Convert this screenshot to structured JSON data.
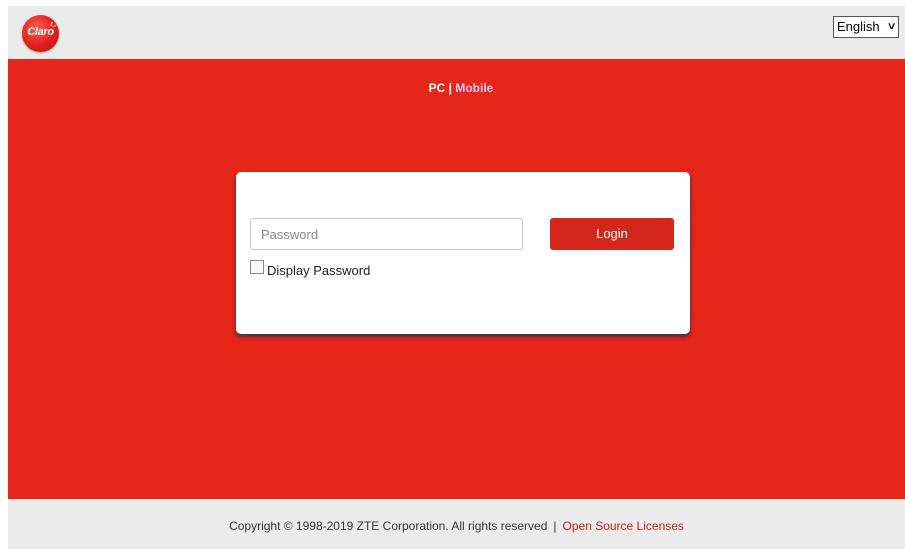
{
  "header": {
    "logo_text": "Claro",
    "language": {
      "selected": "English"
    }
  },
  "main": {
    "view_switch": {
      "pc": "PC",
      "separator": "|",
      "mobile": "Mobile"
    },
    "login": {
      "password_placeholder": "Password",
      "login_label": "Login",
      "display_password_label": "Display Password",
      "display_password_checked": false
    }
  },
  "footer": {
    "copyright": "Copyright © 1998-2019 ZTE Corporation. All rights reserved",
    "separator": "|",
    "license_link": "Open Source Licenses"
  },
  "colors": {
    "brand_red": "#e52618",
    "button_red": "#d4261a",
    "link_red": "#c8211c",
    "mobile_link": "#d9c9ff",
    "header_bg": "#ebebeb"
  },
  "icons": {
    "logo": "claro-logo-icon",
    "dropdown": "chevron-down-icon",
    "checkbox": "checkbox-icon"
  }
}
